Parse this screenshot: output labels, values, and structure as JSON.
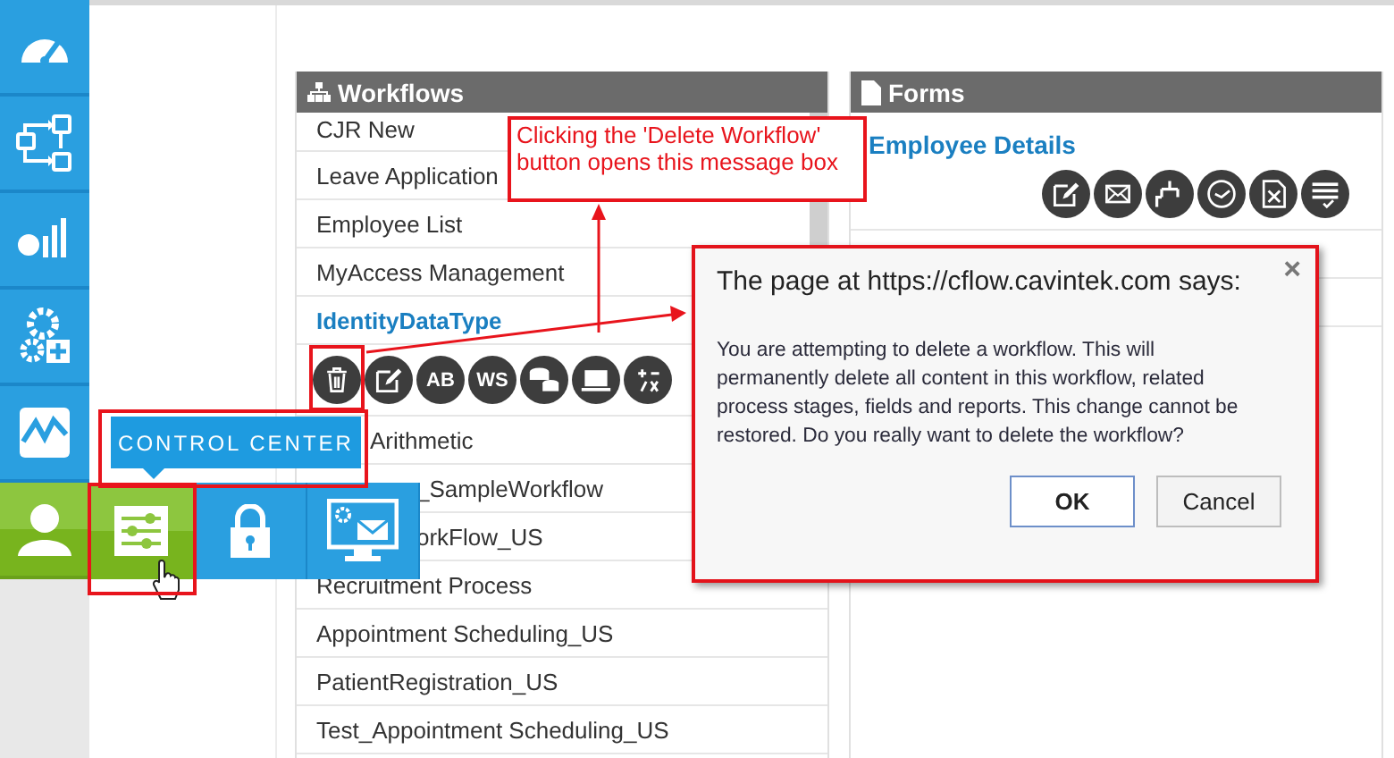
{
  "sidebar": {
    "items": [
      {
        "selected": false
      },
      {
        "selected": false
      },
      {
        "selected": false
      },
      {
        "selected": false
      },
      {
        "selected": false
      },
      {
        "selected": true
      }
    ]
  },
  "control_menu": {
    "tooltip": "CONTROL CENTER",
    "items": [
      {
        "selected": true
      },
      {
        "selected": false
      },
      {
        "selected": false
      }
    ]
  },
  "workflows": {
    "title": "Workflows",
    "items": [
      {
        "label": "CJR New",
        "selected": false,
        "kind": "plain"
      },
      {
        "label": "Leave Application",
        "selected": false,
        "kind": "plain"
      },
      {
        "label": "Employee List",
        "selected": false,
        "kind": "plain"
      },
      {
        "label": "MyAccess Management",
        "selected": false,
        "kind": "plain"
      },
      {
        "label": "IdentityDataType",
        "selected": true,
        "kind": "plain"
      },
      {
        "label": "Arithmetic",
        "selected": false,
        "kind": "behind_tooltip"
      },
      {
        "label": "_SampleWorkflow",
        "selected": false,
        "kind": "behind_menu"
      },
      {
        "label": "orkFlow_US",
        "selected": false,
        "kind": "behind_menu"
      },
      {
        "label": "Recruitment Process",
        "selected": false,
        "kind": "plain"
      },
      {
        "label": "Appointment Scheduling_US",
        "selected": false,
        "kind": "plain"
      },
      {
        "label": "PatientRegistration_US",
        "selected": false,
        "kind": "plain"
      },
      {
        "label": "Test_Appointment Scheduling_US",
        "selected": false,
        "kind": "plain"
      }
    ],
    "actions": [
      {
        "kind": "trash"
      },
      {
        "kind": "edit"
      },
      {
        "kind": "text",
        "label": "AB"
      },
      {
        "kind": "text",
        "label": "WS"
      },
      {
        "kind": "database"
      },
      {
        "kind": "screen"
      },
      {
        "kind": "math"
      }
    ]
  },
  "forms": {
    "title": "Forms",
    "items": [
      {
        "label": "Employee Details",
        "selected": true
      }
    ],
    "actions": [
      {
        "kind": "edit"
      },
      {
        "kind": "mail"
      },
      {
        "kind": "flow"
      },
      {
        "kind": "clock"
      },
      {
        "kind": "sheet"
      },
      {
        "kind": "list"
      }
    ]
  },
  "callout": {
    "text": "Clicking the 'Delete Workflow' button opens this message box"
  },
  "dialog": {
    "title": "The page at https://cflow.cavintek.com says:",
    "close": "×",
    "message": "You are attempting to delete a workflow. This will permanently delete all content in this workflow, related process stages, fields and reports. This change cannot be restored. Do you really want to delete the workflow?",
    "buttons": [
      {
        "label": "OK",
        "default": true
      },
      {
        "label": "Cancel",
        "default": false
      }
    ]
  }
}
